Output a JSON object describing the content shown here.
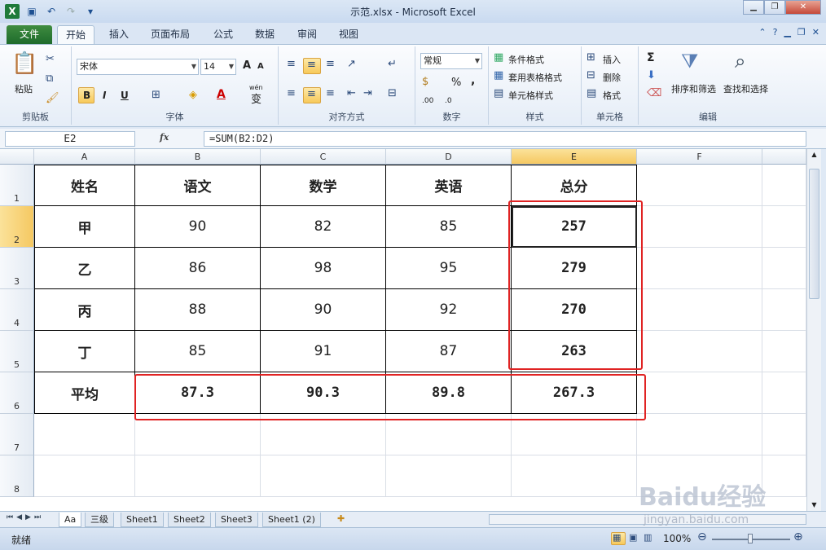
{
  "window": {
    "title": "示范.xlsx - Microsoft Excel"
  },
  "tabs": [
    "文件",
    "开始",
    "插入",
    "页面布局",
    "公式",
    "数据",
    "审阅",
    "视图"
  ],
  "ribbon": {
    "clipboard": {
      "paste": "粘贴",
      "label": "剪贴板"
    },
    "font": {
      "name": "宋体",
      "size": "14",
      "bold": "B",
      "italic": "I",
      "underline": "U",
      "grow": "A",
      "shrink": "A",
      "color_a": "A",
      "wen": "wén",
      "wen_char": "变",
      "label": "字体"
    },
    "alignment": {
      "label": "对齐方式"
    },
    "number": {
      "format": "常规",
      "percent": "%",
      "comma": ",",
      "inc": ".00",
      "dec": ".0",
      "label": "数字"
    },
    "styles": {
      "conditional": "条件格式",
      "table": "套用表格格式",
      "cell": "单元格样式",
      "label": "样式"
    },
    "cells": {
      "insert": "插入",
      "delete": "删除",
      "format": "格式",
      "label": "单元格"
    },
    "editing": {
      "sigma": "Σ",
      "sort": "排序和筛选",
      "find": "查找和选择",
      "label": "编辑"
    }
  },
  "formula_bar": {
    "name_box": "E2",
    "fx": "fx",
    "formula": "=SUM(B2:D2)"
  },
  "grid": {
    "columns": [
      "A",
      "B",
      "C",
      "D",
      "E",
      "F"
    ],
    "rows": [
      "1",
      "2",
      "3",
      "4",
      "5",
      "6",
      "7",
      "8"
    ],
    "cells": [
      [
        "姓名",
        "语文",
        "数学",
        "英语",
        "总分"
      ],
      [
        "甲",
        "90",
        "82",
        "85",
        "257"
      ],
      [
        "乙",
        "86",
        "98",
        "95",
        "279"
      ],
      [
        "丙",
        "88",
        "90",
        "92",
        "270"
      ],
      [
        "丁",
        "85",
        "91",
        "87",
        "263"
      ],
      [
        "平均",
        "87.3",
        "90.3",
        "89.8",
        "267.3"
      ]
    ]
  },
  "sheets": [
    "Aa",
    "三级",
    "Sheet1",
    "Sheet2",
    "Sheet3",
    "Sheet1 (2)"
  ],
  "status": {
    "ready": "就绪",
    "zoom": "100%"
  },
  "watermark": {
    "brand": "Baidu经验",
    "url": "jingyan.baidu.com"
  },
  "colors": {
    "accent_red": "#e02323",
    "selected_header": "#f5c861",
    "file_tab": "#1e6b2c"
  }
}
